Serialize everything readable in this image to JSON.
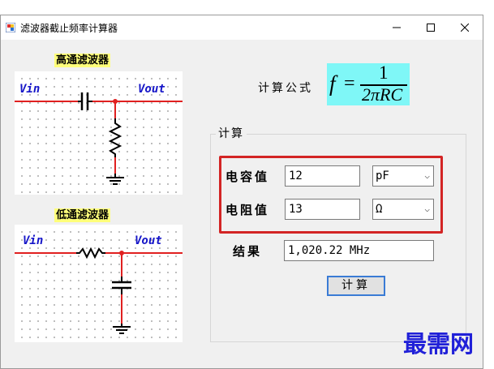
{
  "window": {
    "title": "滤波器截止频率计算器"
  },
  "highpass": {
    "label": "高通滤波器",
    "vin": "Vin",
    "vout": "Vout"
  },
  "lowpass": {
    "label": "低通滤波器",
    "vin": "Vin",
    "vout": "Vout"
  },
  "formula": {
    "label": "计算公式",
    "f": "f",
    "eq": "=",
    "num": "1",
    "den": "2πRC"
  },
  "calc_group": {
    "title": "计算",
    "capacitance_label": "电容值",
    "capacitance_value": "12",
    "capacitance_unit": "pF",
    "resistance_label": "电阻值",
    "resistance_value": "13",
    "resistance_unit": "Ω",
    "result_label": "结果",
    "result_value": "1,020.22 MHz",
    "calc_button": "计算"
  },
  "watermark": "最需网",
  "colors": {
    "formula_bg": "#7ff7f7",
    "label_bg": "#ffff7a",
    "highlight": "#d32424",
    "circuit_red": "#e02020",
    "watermark": "#2020d8"
  },
  "icons": {
    "app": "app-icon",
    "minimize": "minimize-icon",
    "maximize": "maximize-icon",
    "close": "close-icon"
  }
}
